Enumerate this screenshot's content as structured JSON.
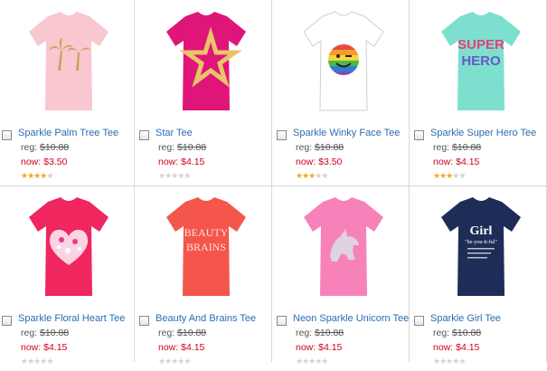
{
  "labels": {
    "reg": "reg:",
    "now": "now:"
  },
  "products": [
    {
      "name": "Sparkle Palm Tree Tee",
      "reg_price": "$10.88",
      "now_price": "$3.50",
      "rating": 4,
      "shirt_color": "#f8c7cf",
      "graphic": "palm-tree-graphic"
    },
    {
      "name": "Star Tee",
      "reg_price": "$10.88",
      "now_price": "$4.15",
      "rating": 0,
      "shirt_color": "#e0157a",
      "graphic": "star-graphic"
    },
    {
      "name": "Sparkle Winky Face Tee",
      "reg_price": "$10.88",
      "now_price": "$3.50",
      "rating": 3,
      "shirt_color": "#ffffff",
      "graphic": "rainbow-winky-face-graphic"
    },
    {
      "name": "Sparkle Super Hero Tee",
      "reg_price": "$10.88",
      "now_price": "$4.15",
      "rating": 3,
      "shirt_color": "#7de0cf",
      "graphic": "super-hero-text-graphic",
      "graphic_text": [
        "SUPER",
        "HERO"
      ]
    },
    {
      "name": "Sparkle Floral Heart Tee",
      "reg_price": "$10.88",
      "now_price": "$4.15",
      "rating": 0,
      "shirt_color": "#f0265e",
      "graphic": "floral-heart-graphic"
    },
    {
      "name": "Beauty And Brains Tee",
      "reg_price": "$10.88",
      "now_price": "$4.15",
      "rating": 0,
      "shirt_color": "#f4564c",
      "graphic": "beauty-brains-text-graphic",
      "graphic_text": [
        "BEAUTY",
        "BRAINS"
      ]
    },
    {
      "name": "Neon Sparkle Unicorn Tee",
      "reg_price": "$10.88",
      "now_price": "$4.15",
      "rating": 0,
      "shirt_color": "#f782b9",
      "graphic": "unicorn-graphic"
    },
    {
      "name": "Sparkle Girl Tee",
      "reg_price": "$10.88",
      "now_price": "$4.15",
      "rating": 0,
      "shirt_color": "#1d2d57",
      "graphic": "girl-definition-graphic",
      "graphic_text": [
        "Girl",
        "\"be-you-ti-ful\""
      ]
    }
  ]
}
